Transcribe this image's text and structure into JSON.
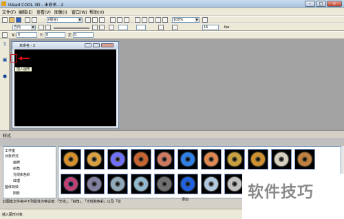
{
  "app": {
    "title": "Ulead COOL 3D - 未命名 - 2"
  },
  "window_buttons": {
    "min": "–",
    "max": "□",
    "close": "×"
  },
  "menu": [
    "文件(F)",
    "编辑(E)",
    "查看(V)",
    "图像(I)",
    "窗口(W)",
    "帮助(H)"
  ],
  "toolbar1": {
    "combo_object": "(组合)",
    "zoom": "100%"
  },
  "toolbar2": {
    "font": "方向"
  },
  "toolbar3": {
    "size_value": "15",
    "fps": "fps"
  },
  "toolbar4": {
    "x_label": "X:",
    "x_value": "0",
    "y_label": "Y:",
    "y_value": "0",
    "z_label": "Z:",
    "z_value": "0"
  },
  "document": {
    "title": "未命名 - 2"
  },
  "tooltip": "插入图形",
  "stylebar": {
    "label": "样式"
  },
  "tree": [
    "工作室",
    "对象样式",
    "画廊",
    "斜角",
    "光线和色彩",
    "纹理",
    "整体特效",
    "阴影"
  ],
  "description": "此图案文件夹中下列属性为特设值:「光线」、「斜角」、「光线和色彩」以及「纹",
  "add_label": "添加",
  "status": "插入图形对象",
  "watermark": "软件技巧",
  "thumbs": [
    {
      "c1": "#d8902c",
      "c2": "#fff0b0"
    },
    {
      "c1": "#d8a040",
      "c2": "#fff4c8"
    },
    {
      "c1": "#7070ff",
      "c2": "#ffffff"
    },
    {
      "c1": "#c86430",
      "c2": "#ffd0a0"
    },
    {
      "c1": "#d07860",
      "c2": "#f8e0d0"
    },
    {
      "c1": "#3080e8",
      "c2": "#80c0ff"
    },
    {
      "c1": "#e08850",
      "c2": "#ffe0c0"
    },
    {
      "c1": "#c8a040",
      "c2": "#fff0a0"
    },
    {
      "c1": "#d09030",
      "c2": "#ffe8a0"
    },
    {
      "c1": "#d8d0c0",
      "c2": "#ffffff"
    },
    {
      "c1": "#c08040",
      "c2": "#f8d890"
    },
    {
      "c1": "#c04070",
      "c2": "#40b0ff"
    },
    {
      "c1": "#8080a0",
      "c2": "#d0d0e8"
    },
    {
      "c1": "#90a8b8",
      "c2": "#e8f0f8"
    },
    {
      "c1": "#90b8d0",
      "c2": "#ffffff"
    },
    {
      "c1": "#707070",
      "c2": "#e0e0e0"
    },
    {
      "c1": "#2060e0",
      "c2": "#80c0ff"
    },
    {
      "c1": "#b0c8e0",
      "c2": "#ffffff"
    },
    {
      "c1": "#c0c0c0",
      "c2": "#ffffff"
    }
  ]
}
